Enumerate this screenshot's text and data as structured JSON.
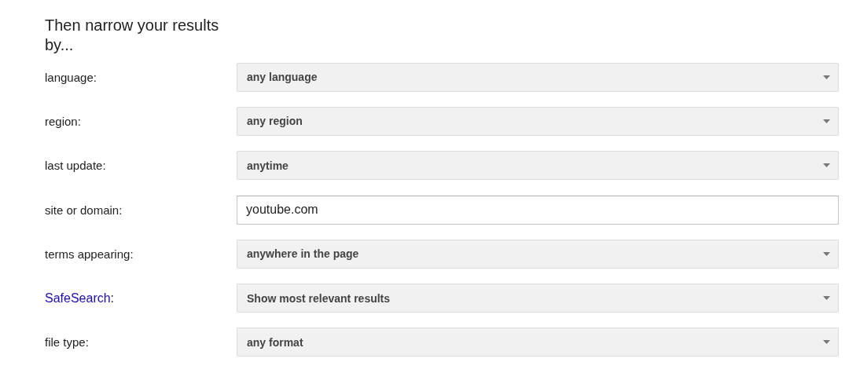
{
  "heading": "Then narrow your results by...",
  "rows": [
    {
      "label": "language:",
      "label_link": false,
      "kind": "select",
      "value": "any language"
    },
    {
      "label": "region:",
      "label_link": false,
      "kind": "select",
      "value": "any region"
    },
    {
      "label": "last update:",
      "label_link": false,
      "kind": "select",
      "value": "anytime"
    },
    {
      "label": "site or domain:",
      "label_link": false,
      "kind": "text",
      "value": "youtube.com"
    },
    {
      "label": "terms appearing:",
      "label_link": false,
      "kind": "select",
      "value": "anywhere in the page"
    },
    {
      "label": "SafeSearch",
      "label_suffix": ":",
      "label_link": true,
      "kind": "select",
      "value": "Show most relevant results"
    },
    {
      "label": "file type:",
      "label_link": false,
      "kind": "select",
      "value": "any format"
    }
  ]
}
